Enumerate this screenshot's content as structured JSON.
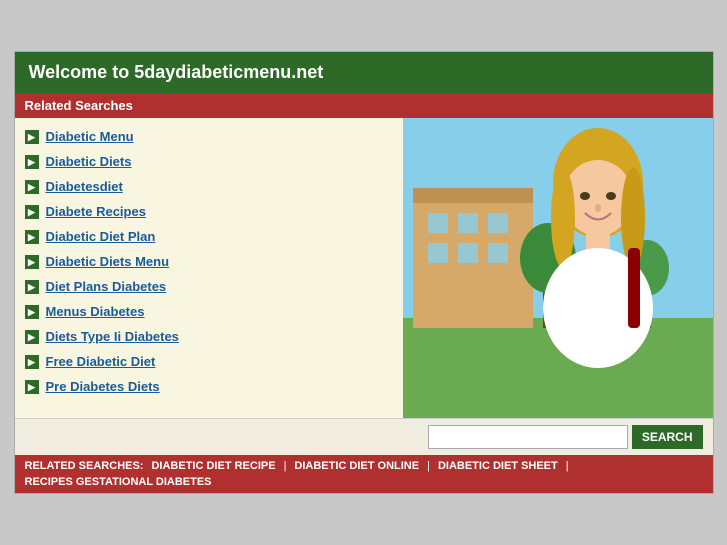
{
  "header": {
    "title": "Welcome to 5daydiabeticmenu.net"
  },
  "related_searches_label": "Related Searches",
  "links": [
    {
      "label": "Diabetic Menu"
    },
    {
      "label": "Diabetic Diets"
    },
    {
      "label": "Diabetesdiet"
    },
    {
      "label": "Diabete Recipes"
    },
    {
      "label": "Diabetic Diet Plan"
    },
    {
      "label": "Diabetic Diets Menu"
    },
    {
      "label": "Diet Plans Diabetes"
    },
    {
      "label": "Menus Diabetes"
    },
    {
      "label": "Diets Type Ii Diabetes"
    },
    {
      "label": "Free Diabetic Diet"
    },
    {
      "label": "Pre Diabetes Diets"
    }
  ],
  "search": {
    "placeholder": "",
    "button_label": "SEARCH"
  },
  "bottom_bar": {
    "label": "RELATED SEARCHES:",
    "items": [
      "DIABETIC DIET RECIPE",
      "DIABETIC DIET ONLINE",
      "DIABETIC DIET SHEET",
      "RECIPES GESTATIONAL DIABETES"
    ]
  }
}
